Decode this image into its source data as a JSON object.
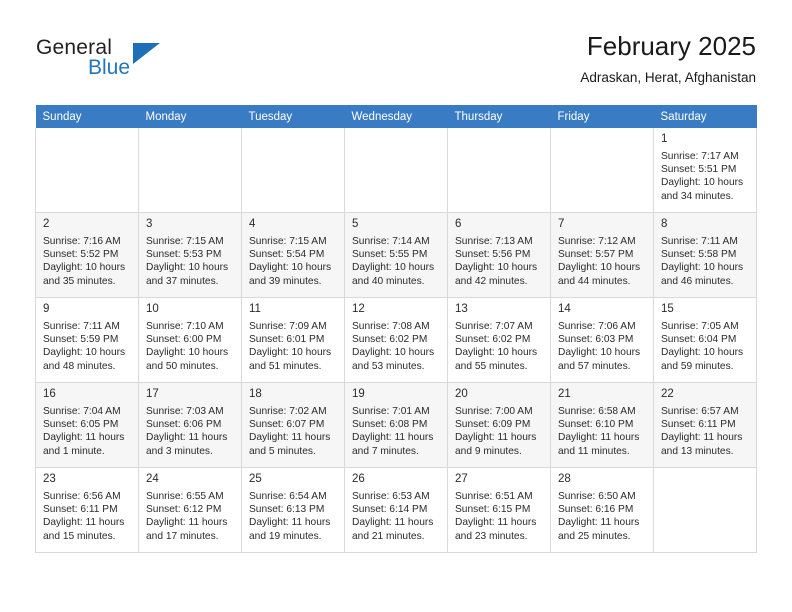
{
  "brand": {
    "word_one": "General",
    "word_two": "Blue",
    "triangle_color": "#1f6fb8",
    "text_color": "#231f20",
    "accent_color": "#2277bb"
  },
  "header": {
    "title": "February 2025",
    "subtitle": "Adraskan, Herat, Afghanistan"
  },
  "theme": {
    "header_row_bg": "#3a7cc3",
    "header_row_text": "#ffffff",
    "shaded_row_bg": "#f6f6f6",
    "grid_line": "#d9d9d9"
  },
  "weekdays": [
    "Sunday",
    "Monday",
    "Tuesday",
    "Wednesday",
    "Thursday",
    "Friday",
    "Saturday"
  ],
  "weeks": [
    {
      "shaded": false,
      "days": [
        {
          "empty": true
        },
        {
          "empty": true
        },
        {
          "empty": true
        },
        {
          "empty": true
        },
        {
          "empty": true
        },
        {
          "empty": true
        },
        {
          "empty": false,
          "date": "1",
          "sunrise": "Sunrise: 7:17 AM",
          "sunset": "Sunset: 5:51 PM",
          "daylight_1": "Daylight: 10 hours",
          "daylight_2": "and 34 minutes."
        }
      ]
    },
    {
      "shaded": true,
      "days": [
        {
          "empty": false,
          "date": "2",
          "sunrise": "Sunrise: 7:16 AM",
          "sunset": "Sunset: 5:52 PM",
          "daylight_1": "Daylight: 10 hours",
          "daylight_2": "and 35 minutes."
        },
        {
          "empty": false,
          "date": "3",
          "sunrise": "Sunrise: 7:15 AM",
          "sunset": "Sunset: 5:53 PM",
          "daylight_1": "Daylight: 10 hours",
          "daylight_2": "and 37 minutes."
        },
        {
          "empty": false,
          "date": "4",
          "sunrise": "Sunrise: 7:15 AM",
          "sunset": "Sunset: 5:54 PM",
          "daylight_1": "Daylight: 10 hours",
          "daylight_2": "and 39 minutes."
        },
        {
          "empty": false,
          "date": "5",
          "sunrise": "Sunrise: 7:14 AM",
          "sunset": "Sunset: 5:55 PM",
          "daylight_1": "Daylight: 10 hours",
          "daylight_2": "and 40 minutes."
        },
        {
          "empty": false,
          "date": "6",
          "sunrise": "Sunrise: 7:13 AM",
          "sunset": "Sunset: 5:56 PM",
          "daylight_1": "Daylight: 10 hours",
          "daylight_2": "and 42 minutes."
        },
        {
          "empty": false,
          "date": "7",
          "sunrise": "Sunrise: 7:12 AM",
          "sunset": "Sunset: 5:57 PM",
          "daylight_1": "Daylight: 10 hours",
          "daylight_2": "and 44 minutes."
        },
        {
          "empty": false,
          "date": "8",
          "sunrise": "Sunrise: 7:11 AM",
          "sunset": "Sunset: 5:58 PM",
          "daylight_1": "Daylight: 10 hours",
          "daylight_2": "and 46 minutes."
        }
      ]
    },
    {
      "shaded": false,
      "days": [
        {
          "empty": false,
          "date": "9",
          "sunrise": "Sunrise: 7:11 AM",
          "sunset": "Sunset: 5:59 PM",
          "daylight_1": "Daylight: 10 hours",
          "daylight_2": "and 48 minutes."
        },
        {
          "empty": false,
          "date": "10",
          "sunrise": "Sunrise: 7:10 AM",
          "sunset": "Sunset: 6:00 PM",
          "daylight_1": "Daylight: 10 hours",
          "daylight_2": "and 50 minutes."
        },
        {
          "empty": false,
          "date": "11",
          "sunrise": "Sunrise: 7:09 AM",
          "sunset": "Sunset: 6:01 PM",
          "daylight_1": "Daylight: 10 hours",
          "daylight_2": "and 51 minutes."
        },
        {
          "empty": false,
          "date": "12",
          "sunrise": "Sunrise: 7:08 AM",
          "sunset": "Sunset: 6:02 PM",
          "daylight_1": "Daylight: 10 hours",
          "daylight_2": "and 53 minutes."
        },
        {
          "empty": false,
          "date": "13",
          "sunrise": "Sunrise: 7:07 AM",
          "sunset": "Sunset: 6:02 PM",
          "daylight_1": "Daylight: 10 hours",
          "daylight_2": "and 55 minutes."
        },
        {
          "empty": false,
          "date": "14",
          "sunrise": "Sunrise: 7:06 AM",
          "sunset": "Sunset: 6:03 PM",
          "daylight_1": "Daylight: 10 hours",
          "daylight_2": "and 57 minutes."
        },
        {
          "empty": false,
          "date": "15",
          "sunrise": "Sunrise: 7:05 AM",
          "sunset": "Sunset: 6:04 PM",
          "daylight_1": "Daylight: 10 hours",
          "daylight_2": "and 59 minutes."
        }
      ]
    },
    {
      "shaded": true,
      "days": [
        {
          "empty": false,
          "date": "16",
          "sunrise": "Sunrise: 7:04 AM",
          "sunset": "Sunset: 6:05 PM",
          "daylight_1": "Daylight: 11 hours",
          "daylight_2": "and 1 minute."
        },
        {
          "empty": false,
          "date": "17",
          "sunrise": "Sunrise: 7:03 AM",
          "sunset": "Sunset: 6:06 PM",
          "daylight_1": "Daylight: 11 hours",
          "daylight_2": "and 3 minutes."
        },
        {
          "empty": false,
          "date": "18",
          "sunrise": "Sunrise: 7:02 AM",
          "sunset": "Sunset: 6:07 PM",
          "daylight_1": "Daylight: 11 hours",
          "daylight_2": "and 5 minutes."
        },
        {
          "empty": false,
          "date": "19",
          "sunrise": "Sunrise: 7:01 AM",
          "sunset": "Sunset: 6:08 PM",
          "daylight_1": "Daylight: 11 hours",
          "daylight_2": "and 7 minutes."
        },
        {
          "empty": false,
          "date": "20",
          "sunrise": "Sunrise: 7:00 AM",
          "sunset": "Sunset: 6:09 PM",
          "daylight_1": "Daylight: 11 hours",
          "daylight_2": "and 9 minutes."
        },
        {
          "empty": false,
          "date": "21",
          "sunrise": "Sunrise: 6:58 AM",
          "sunset": "Sunset: 6:10 PM",
          "daylight_1": "Daylight: 11 hours",
          "daylight_2": "and 11 minutes."
        },
        {
          "empty": false,
          "date": "22",
          "sunrise": "Sunrise: 6:57 AM",
          "sunset": "Sunset: 6:11 PM",
          "daylight_1": "Daylight: 11 hours",
          "daylight_2": "and 13 minutes."
        }
      ]
    },
    {
      "shaded": false,
      "days": [
        {
          "empty": false,
          "date": "23",
          "sunrise": "Sunrise: 6:56 AM",
          "sunset": "Sunset: 6:11 PM",
          "daylight_1": "Daylight: 11 hours",
          "daylight_2": "and 15 minutes."
        },
        {
          "empty": false,
          "date": "24",
          "sunrise": "Sunrise: 6:55 AM",
          "sunset": "Sunset: 6:12 PM",
          "daylight_1": "Daylight: 11 hours",
          "daylight_2": "and 17 minutes."
        },
        {
          "empty": false,
          "date": "25",
          "sunrise": "Sunrise: 6:54 AM",
          "sunset": "Sunset: 6:13 PM",
          "daylight_1": "Daylight: 11 hours",
          "daylight_2": "and 19 minutes."
        },
        {
          "empty": false,
          "date": "26",
          "sunrise": "Sunrise: 6:53 AM",
          "sunset": "Sunset: 6:14 PM",
          "daylight_1": "Daylight: 11 hours",
          "daylight_2": "and 21 minutes."
        },
        {
          "empty": false,
          "date": "27",
          "sunrise": "Sunrise: 6:51 AM",
          "sunset": "Sunset: 6:15 PM",
          "daylight_1": "Daylight: 11 hours",
          "daylight_2": "and 23 minutes."
        },
        {
          "empty": false,
          "date": "28",
          "sunrise": "Sunrise: 6:50 AM",
          "sunset": "Sunset: 6:16 PM",
          "daylight_1": "Daylight: 11 hours",
          "daylight_2": "and 25 minutes."
        },
        {
          "empty": true
        }
      ]
    }
  ]
}
